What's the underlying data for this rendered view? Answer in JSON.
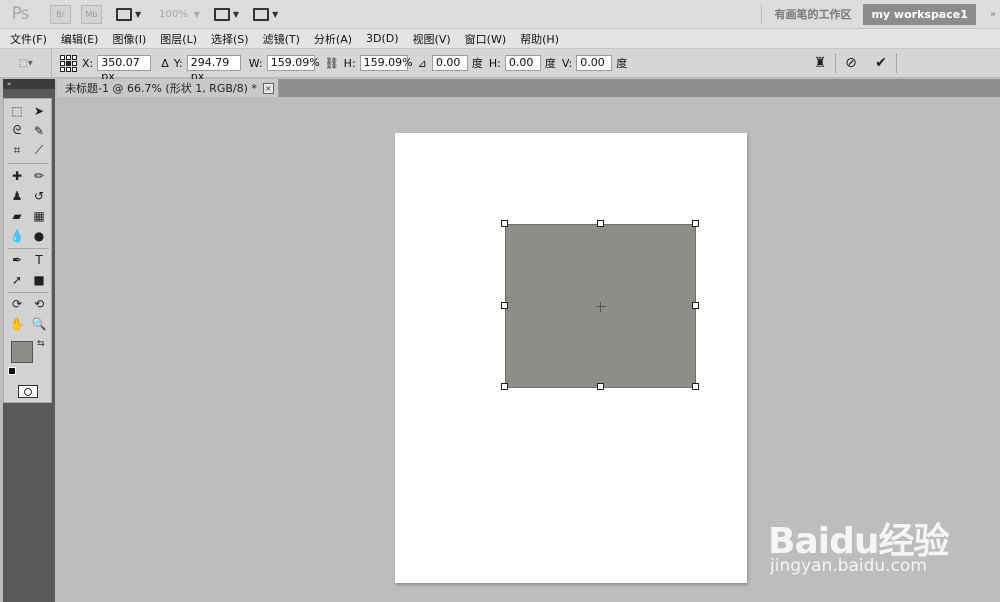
{
  "app": {
    "logo": "Ps",
    "bridge_label": "Br",
    "minibridge_label": "Mb",
    "zoom_level": "100%",
    "workspace_inactive": "有画笔的工作区",
    "workspace_active": "my workspace1",
    "workspace_more": "»"
  },
  "menu": [
    "文件(F)",
    "编辑(E)",
    "图像(I)",
    "图层(L)",
    "选择(S)",
    "滤镜(T)",
    "分析(A)",
    "3D(D)",
    "视图(V)",
    "窗口(W)",
    "帮助(H)"
  ],
  "options": {
    "x_label": "X:",
    "x_value": "350.07 px",
    "delta_label": "Δ",
    "y_label": "Y:",
    "y_value": "294.79 px",
    "w_label": "W:",
    "w_value": "159.09%",
    "h_label": "H:",
    "h_value": "159.09%",
    "angle_value": "0.00",
    "angle_unit": "度",
    "skew_h_label": "H:",
    "skew_h_value": "0.00",
    "skew_h_unit": "度",
    "skew_v_label": "V:",
    "skew_v_value": "0.00",
    "skew_v_unit": "度"
  },
  "toolpanel": {
    "collapse": "«"
  },
  "document": {
    "tab_title": "未标题-1 @ 66.7% (形状 1, RGB/8) *",
    "close": "×"
  },
  "colors": {
    "foreground": "#8c8e8a",
    "background": "#ffffff",
    "shape_fill": "#8c8e8a"
  },
  "watermark": {
    "line1": "Baidu经验",
    "line2": "jingyan.baidu.com"
  }
}
